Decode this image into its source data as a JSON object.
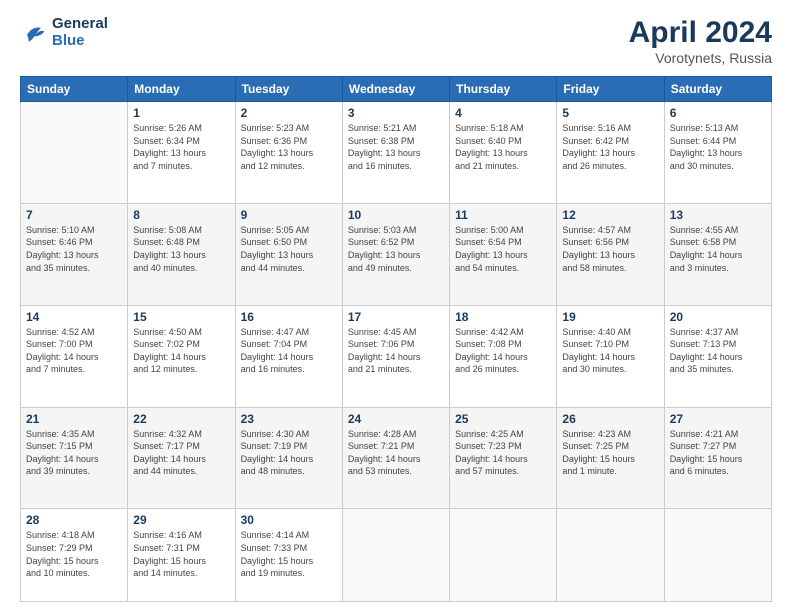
{
  "header": {
    "logo_line1": "General",
    "logo_line2": "Blue",
    "month": "April 2024",
    "location": "Vorotynets, Russia"
  },
  "days_of_week": [
    "Sunday",
    "Monday",
    "Tuesday",
    "Wednesday",
    "Thursday",
    "Friday",
    "Saturday"
  ],
  "weeks": [
    [
      {
        "day": "",
        "info": ""
      },
      {
        "day": "1",
        "info": "Sunrise: 5:26 AM\nSunset: 6:34 PM\nDaylight: 13 hours\nand 7 minutes."
      },
      {
        "day": "2",
        "info": "Sunrise: 5:23 AM\nSunset: 6:36 PM\nDaylight: 13 hours\nand 12 minutes."
      },
      {
        "day": "3",
        "info": "Sunrise: 5:21 AM\nSunset: 6:38 PM\nDaylight: 13 hours\nand 16 minutes."
      },
      {
        "day": "4",
        "info": "Sunrise: 5:18 AM\nSunset: 6:40 PM\nDaylight: 13 hours\nand 21 minutes."
      },
      {
        "day": "5",
        "info": "Sunrise: 5:16 AM\nSunset: 6:42 PM\nDaylight: 13 hours\nand 26 minutes."
      },
      {
        "day": "6",
        "info": "Sunrise: 5:13 AM\nSunset: 6:44 PM\nDaylight: 13 hours\nand 30 minutes."
      }
    ],
    [
      {
        "day": "7",
        "info": "Sunrise: 5:10 AM\nSunset: 6:46 PM\nDaylight: 13 hours\nand 35 minutes."
      },
      {
        "day": "8",
        "info": "Sunrise: 5:08 AM\nSunset: 6:48 PM\nDaylight: 13 hours\nand 40 minutes."
      },
      {
        "day": "9",
        "info": "Sunrise: 5:05 AM\nSunset: 6:50 PM\nDaylight: 13 hours\nand 44 minutes."
      },
      {
        "day": "10",
        "info": "Sunrise: 5:03 AM\nSunset: 6:52 PM\nDaylight: 13 hours\nand 49 minutes."
      },
      {
        "day": "11",
        "info": "Sunrise: 5:00 AM\nSunset: 6:54 PM\nDaylight: 13 hours\nand 54 minutes."
      },
      {
        "day": "12",
        "info": "Sunrise: 4:57 AM\nSunset: 6:56 PM\nDaylight: 13 hours\nand 58 minutes."
      },
      {
        "day": "13",
        "info": "Sunrise: 4:55 AM\nSunset: 6:58 PM\nDaylight: 14 hours\nand 3 minutes."
      }
    ],
    [
      {
        "day": "14",
        "info": "Sunrise: 4:52 AM\nSunset: 7:00 PM\nDaylight: 14 hours\nand 7 minutes."
      },
      {
        "day": "15",
        "info": "Sunrise: 4:50 AM\nSunset: 7:02 PM\nDaylight: 14 hours\nand 12 minutes."
      },
      {
        "day": "16",
        "info": "Sunrise: 4:47 AM\nSunset: 7:04 PM\nDaylight: 14 hours\nand 16 minutes."
      },
      {
        "day": "17",
        "info": "Sunrise: 4:45 AM\nSunset: 7:06 PM\nDaylight: 14 hours\nand 21 minutes."
      },
      {
        "day": "18",
        "info": "Sunrise: 4:42 AM\nSunset: 7:08 PM\nDaylight: 14 hours\nand 26 minutes."
      },
      {
        "day": "19",
        "info": "Sunrise: 4:40 AM\nSunset: 7:10 PM\nDaylight: 14 hours\nand 30 minutes."
      },
      {
        "day": "20",
        "info": "Sunrise: 4:37 AM\nSunset: 7:13 PM\nDaylight: 14 hours\nand 35 minutes."
      }
    ],
    [
      {
        "day": "21",
        "info": "Sunrise: 4:35 AM\nSunset: 7:15 PM\nDaylight: 14 hours\nand 39 minutes."
      },
      {
        "day": "22",
        "info": "Sunrise: 4:32 AM\nSunset: 7:17 PM\nDaylight: 14 hours\nand 44 minutes."
      },
      {
        "day": "23",
        "info": "Sunrise: 4:30 AM\nSunset: 7:19 PM\nDaylight: 14 hours\nand 48 minutes."
      },
      {
        "day": "24",
        "info": "Sunrise: 4:28 AM\nSunset: 7:21 PM\nDaylight: 14 hours\nand 53 minutes."
      },
      {
        "day": "25",
        "info": "Sunrise: 4:25 AM\nSunset: 7:23 PM\nDaylight: 14 hours\nand 57 minutes."
      },
      {
        "day": "26",
        "info": "Sunrise: 4:23 AM\nSunset: 7:25 PM\nDaylight: 15 hours\nand 1 minute."
      },
      {
        "day": "27",
        "info": "Sunrise: 4:21 AM\nSunset: 7:27 PM\nDaylight: 15 hours\nand 6 minutes."
      }
    ],
    [
      {
        "day": "28",
        "info": "Sunrise: 4:18 AM\nSunset: 7:29 PM\nDaylight: 15 hours\nand 10 minutes."
      },
      {
        "day": "29",
        "info": "Sunrise: 4:16 AM\nSunset: 7:31 PM\nDaylight: 15 hours\nand 14 minutes."
      },
      {
        "day": "30",
        "info": "Sunrise: 4:14 AM\nSunset: 7:33 PM\nDaylight: 15 hours\nand 19 minutes."
      },
      {
        "day": "",
        "info": ""
      },
      {
        "day": "",
        "info": ""
      },
      {
        "day": "",
        "info": ""
      },
      {
        "day": "",
        "info": ""
      }
    ]
  ]
}
